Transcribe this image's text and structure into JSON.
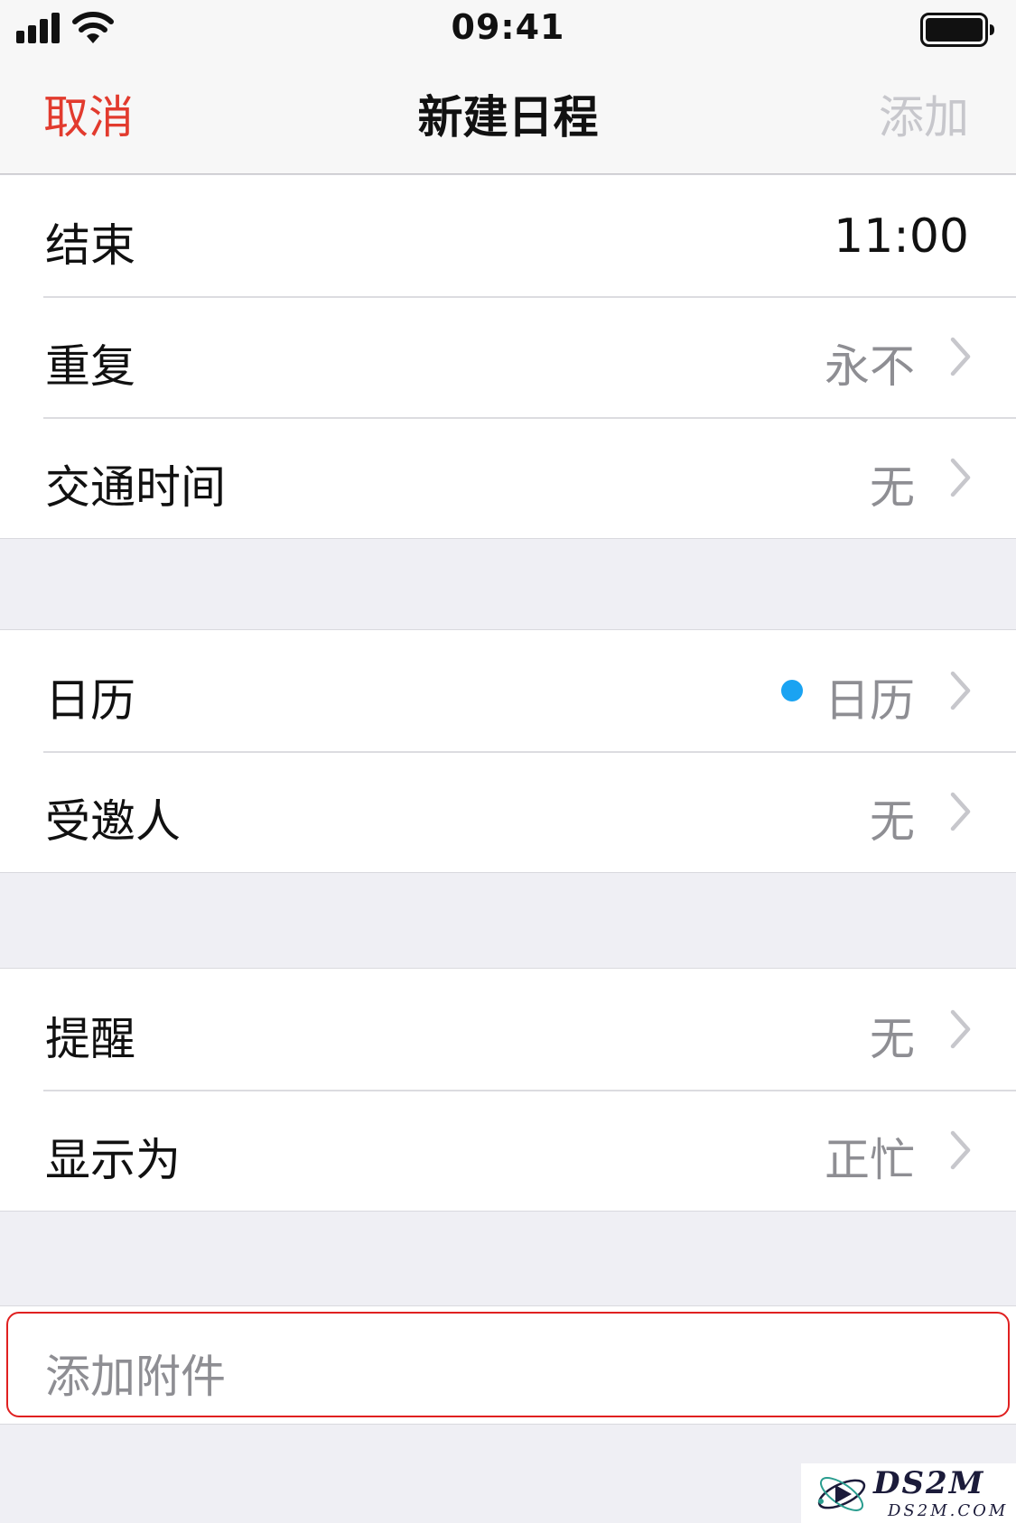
{
  "status_bar": {
    "time": "09:41",
    "icons": [
      "signal-icon",
      "wifi-icon",
      "battery-icon"
    ]
  },
  "nav": {
    "cancel": "取消",
    "title": "新建日程",
    "add": "添加"
  },
  "colors": {
    "cancel": "#e23b2e",
    "add_disabled": "#c7c7cc",
    "calendar_dot": "#1aa3f2",
    "highlight_border": "#e02020",
    "secondary_text": "#8e8e93"
  },
  "group1": {
    "end": {
      "label": "结束",
      "value": "11:00"
    },
    "repeat": {
      "label": "重复",
      "value": "永不"
    },
    "travel_time": {
      "label": "交通时间",
      "value": "无"
    }
  },
  "group2": {
    "calendar": {
      "label": "日历",
      "value": "日历"
    },
    "invitees": {
      "label": "受邀人",
      "value": "无"
    }
  },
  "group3": {
    "alert": {
      "label": "提醒",
      "value": "无"
    },
    "show_as": {
      "label": "显示为",
      "value": "正忙"
    }
  },
  "group4": {
    "add_attachment": {
      "label": "添加附件"
    }
  },
  "watermark": {
    "title": "DS2M",
    "subtitle": "DS2M.COM"
  }
}
